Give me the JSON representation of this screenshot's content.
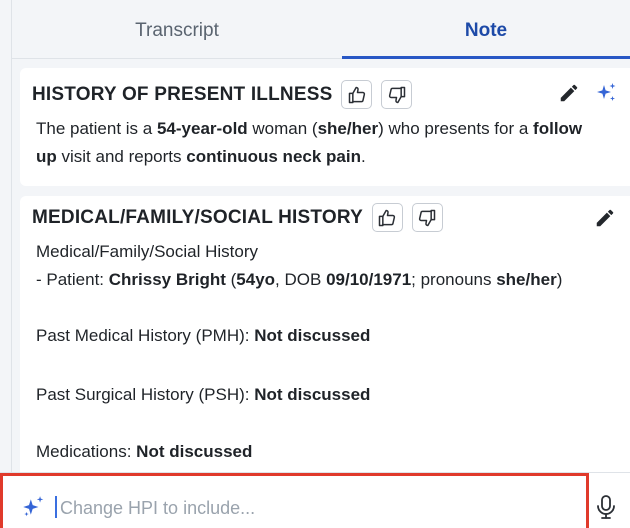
{
  "tabs": [
    {
      "label": "Transcript",
      "active": false
    },
    {
      "label": "Note",
      "active": true
    }
  ],
  "hpi": {
    "title": "HISTORY OF PRESENT ILLNESS",
    "line1": {
      "t1": "The patient is a ",
      "b1": "54-year-old",
      "t2": " woman (",
      "b2": "she/her",
      "t3": ") who presents for a ",
      "b3": "follow"
    },
    "line2": {
      "b1": "up",
      "t1": " visit and reports ",
      "b2": "continuous neck pain",
      "t2": "."
    }
  },
  "mfsh": {
    "title": "MEDICAL/FAMILY/SOCIAL HISTORY",
    "subtitle": "Medical/Family/Social History",
    "patient_line": {
      "t1": "- Patient: ",
      "b1": "Chrissy Bright",
      "t2": " (",
      "b2": "54yo",
      "t3": ", DOB ",
      "b3": "09/10/1971",
      "t4": "; pronouns ",
      "b4": "she/her",
      "t5": ")"
    },
    "pmh": {
      "label": "Past Medical History (PMH): ",
      "value": "Not discussed"
    },
    "psh": {
      "label": "Past Surgical History (PSH): ",
      "value": "Not discussed"
    },
    "meds": {
      "label": "Medications: ",
      "value": "Not discussed"
    }
  },
  "input": {
    "placeholder": "Change HPI to include...",
    "value": ""
  },
  "icons": {
    "thumbs_up": "thumbs-up-icon",
    "thumbs_down": "thumbs-down-icon",
    "edit": "pencil-icon",
    "ai": "sparkle-icon",
    "mic": "microphone-icon"
  },
  "colors": {
    "accent": "#2857c5",
    "highlight_border": "#e03a2b",
    "sparkle": "#3565d6"
  }
}
